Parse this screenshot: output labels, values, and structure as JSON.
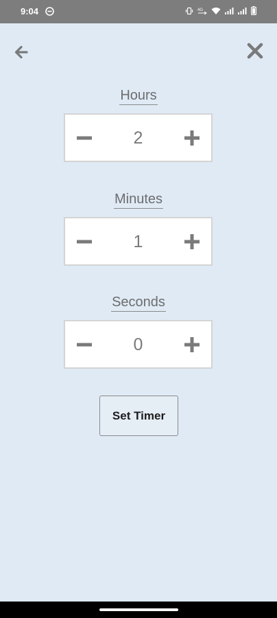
{
  "status_bar": {
    "time": "9:04",
    "icons": [
      "do-not-disturb-icon",
      "vibrate-icon",
      "volte-icon",
      "wifi-icon",
      "signal-icon",
      "signal-icon",
      "battery-icon"
    ]
  },
  "header": {
    "back_icon": "arrow-left-icon",
    "close_icon": "close-x-icon"
  },
  "hours": {
    "label": "Hours",
    "value": "2"
  },
  "minutes": {
    "label": "Minutes",
    "value": "1"
  },
  "seconds": {
    "label": "Seconds",
    "value": "0"
  },
  "set_timer_label": "Set Timer",
  "colors": {
    "background": "#dfeaf5",
    "status_bar": "#7d7d7d",
    "icon_gray": "#7a7a7a"
  }
}
